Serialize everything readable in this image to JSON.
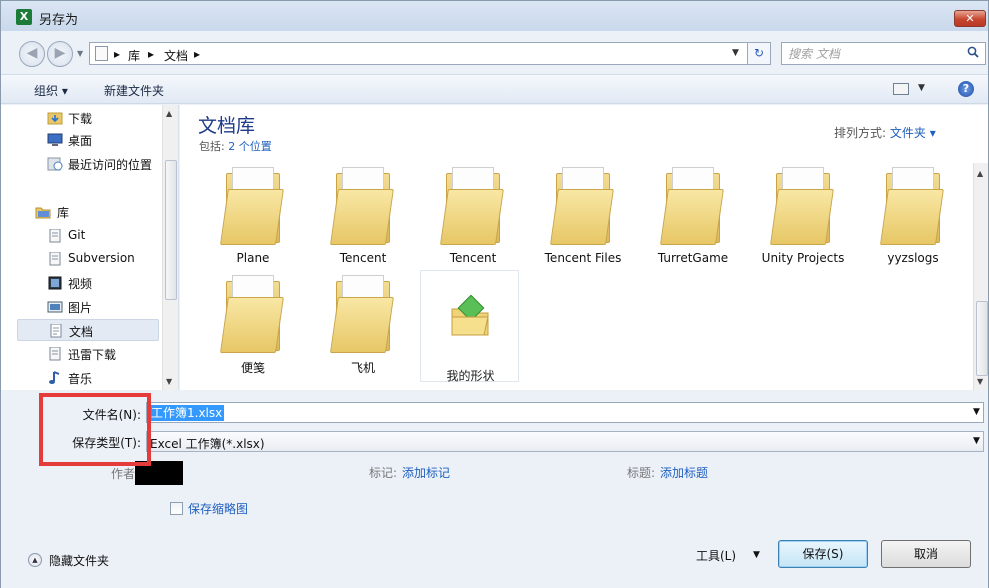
{
  "window": {
    "title": "另存为",
    "close_glyph": "✕"
  },
  "address": {
    "crumbs": [
      "库",
      "文档"
    ],
    "search_placeholder": "搜索 文档"
  },
  "toolbar": {
    "organize_label": "组织 ▾",
    "new_folder_label": "新建文件夹"
  },
  "nav": {
    "items": [
      {
        "label": "下载",
        "icon": "download-folder-icon"
      },
      {
        "label": "桌面",
        "icon": "desktop-icon"
      },
      {
        "label": "最近访问的位置",
        "icon": "recent-places-icon"
      },
      {
        "label": "库",
        "icon": "library-icon"
      },
      {
        "label": "Git",
        "icon": "library-doc-icon"
      },
      {
        "label": "Subversion",
        "icon": "library-doc-icon"
      },
      {
        "label": "视频",
        "icon": "videos-icon"
      },
      {
        "label": "图片",
        "icon": "pictures-icon"
      },
      {
        "label": "文档",
        "icon": "documents-icon",
        "selected": true
      },
      {
        "label": "迅雷下载",
        "icon": "library-doc-icon"
      },
      {
        "label": "音乐",
        "icon": "music-icon"
      }
    ]
  },
  "content": {
    "library_title": "文档库",
    "includes_prefix": "包括:",
    "includes_link": "2 个位置",
    "arrange_label": "排列方式:",
    "arrange_value": "文件夹 ▾",
    "folders": [
      "Plane",
      "Tencent",
      "Tencent",
      "Tencent Files",
      "TurretGame",
      "Unity Projects",
      "yyzslogs",
      "便笺",
      "飞机"
    ],
    "shape_file": "我的形状"
  },
  "save": {
    "filename_label": "文件名(N):",
    "filename_value": "工作簿1.xlsx",
    "type_label": "保存类型(T):",
    "type_value": "Excel 工作簿(*.xlsx)",
    "author_label": "作者:",
    "tags_label": "标记:",
    "tags_link": "添加标记",
    "title_label": "标题:",
    "title_link": "添加标题",
    "thumbnail_label": "保存缩略图",
    "hide_folders_label": "隐藏文件夹",
    "tools_label": "工具(L)",
    "save_button": "保存(S)",
    "cancel_button": "取消"
  },
  "colors": {
    "accent": "#1f5fbf",
    "highlight_box": "#e53b3b",
    "selection": "#3399ff"
  }
}
